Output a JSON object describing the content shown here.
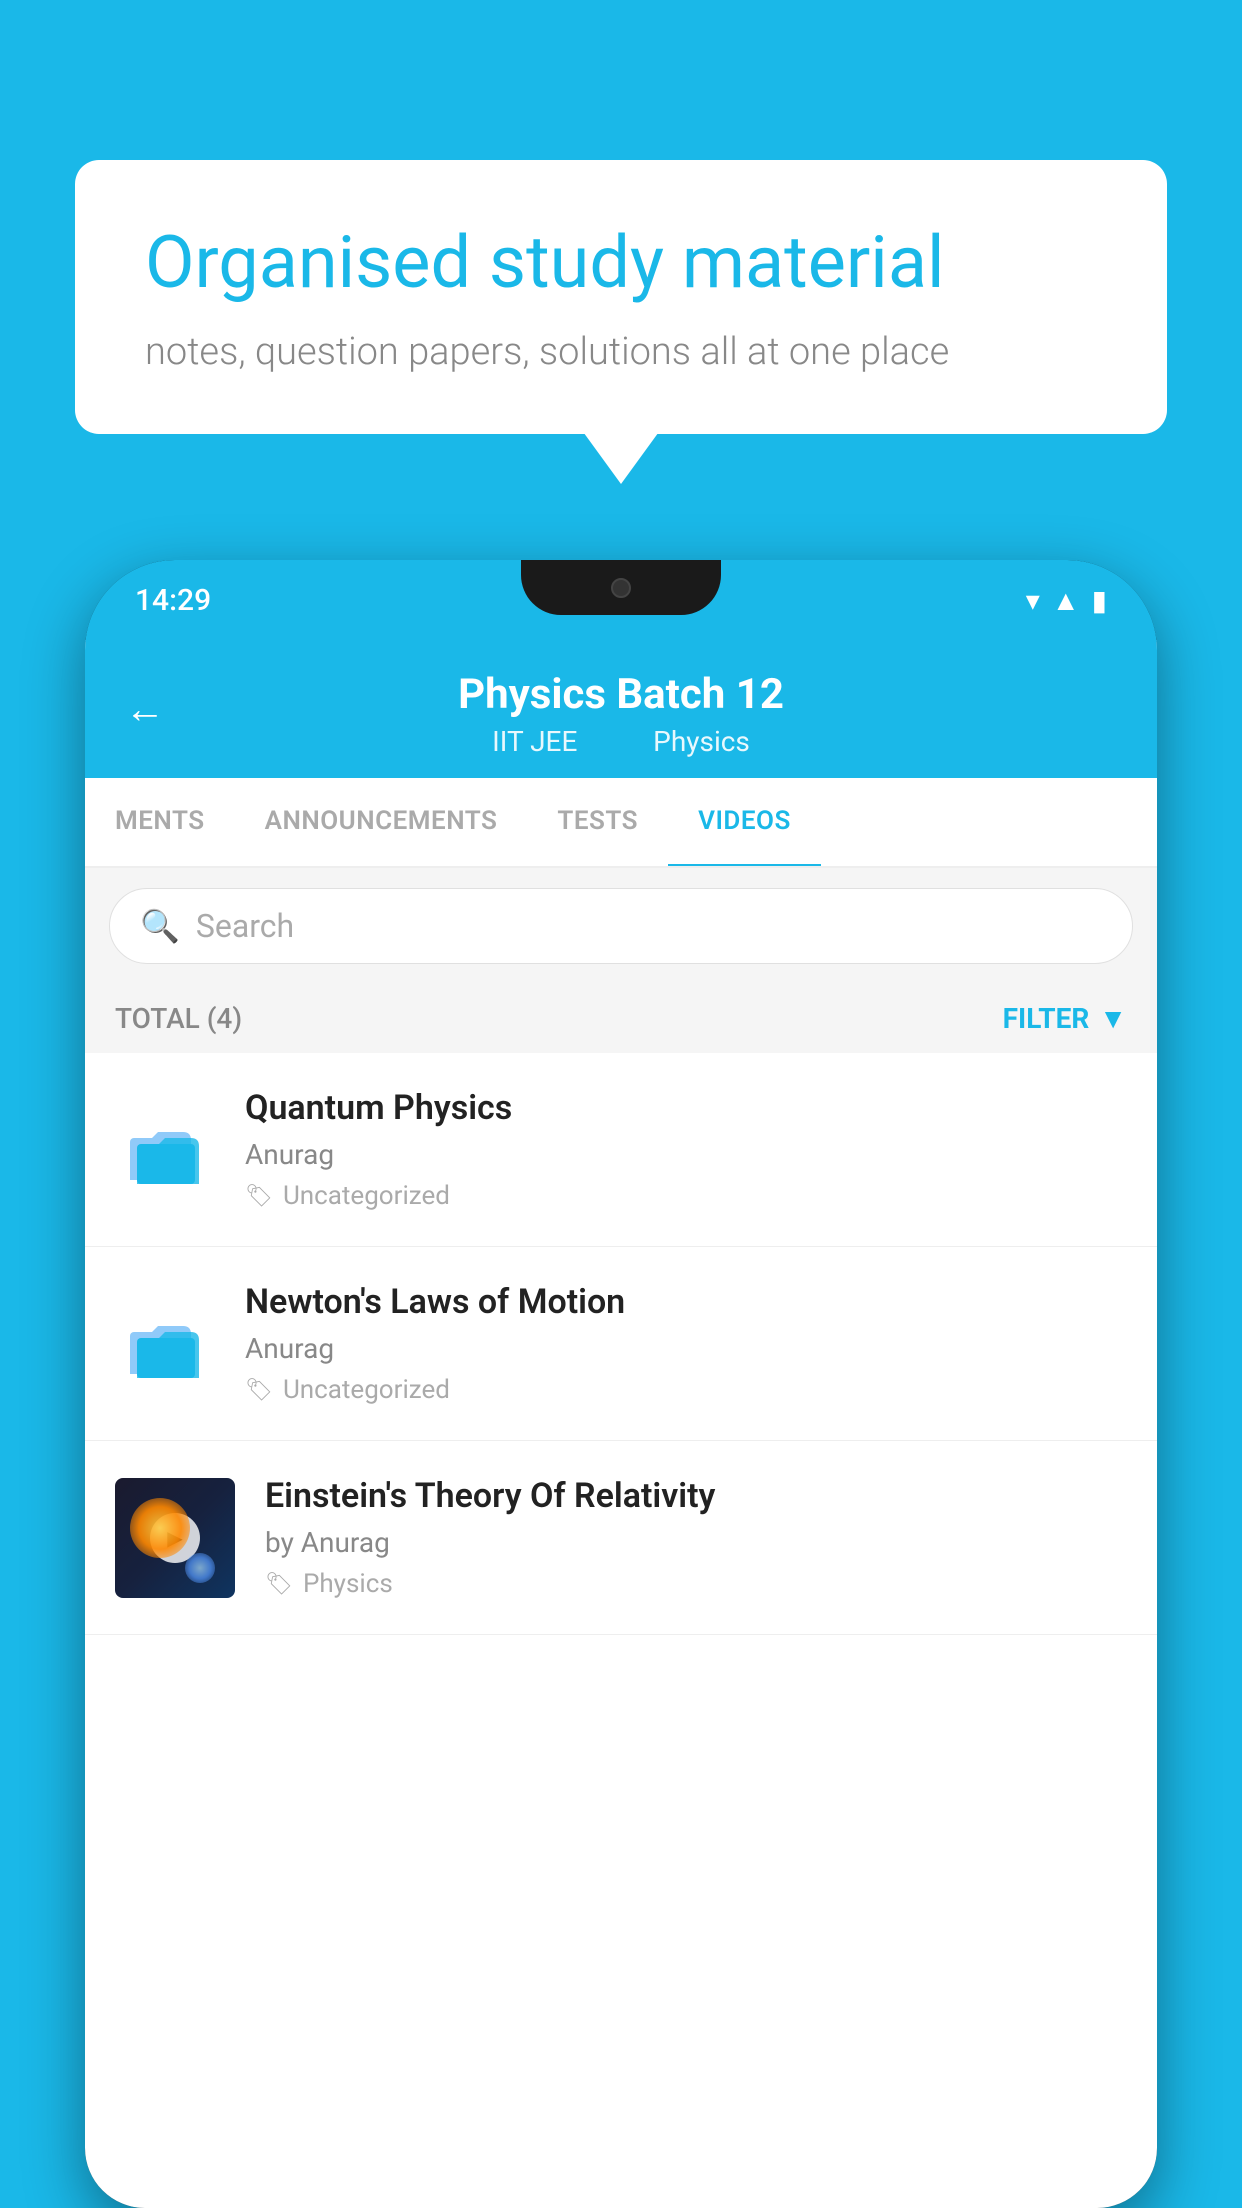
{
  "background_color": "#1ab8e8",
  "speech_bubble": {
    "title": "Organised study material",
    "subtitle": "notes, question papers, solutions all at one place"
  },
  "phone": {
    "status_bar": {
      "time": "14:29"
    },
    "header": {
      "title": "Physics Batch 12",
      "subtitle_part1": "IIT JEE",
      "subtitle_part2": "Physics"
    },
    "tabs": [
      {
        "label": "MENTS",
        "active": false
      },
      {
        "label": "ANNOUNCEMENTS",
        "active": false
      },
      {
        "label": "TESTS",
        "active": false
      },
      {
        "label": "VIDEOS",
        "active": true
      }
    ],
    "search": {
      "placeholder": "Search"
    },
    "filter": {
      "total_label": "TOTAL (4)",
      "filter_label": "FILTER"
    },
    "videos": [
      {
        "id": 1,
        "title": "Quantum Physics",
        "author": "Anurag",
        "tag": "Uncategorized",
        "has_thumbnail": false
      },
      {
        "id": 2,
        "title": "Newton's Laws of Motion",
        "author": "Anurag",
        "tag": "Uncategorized",
        "has_thumbnail": false
      },
      {
        "id": 3,
        "title": "Einstein's Theory Of Relativity",
        "author": "by Anurag",
        "tag": "Physics",
        "has_thumbnail": true
      }
    ]
  }
}
